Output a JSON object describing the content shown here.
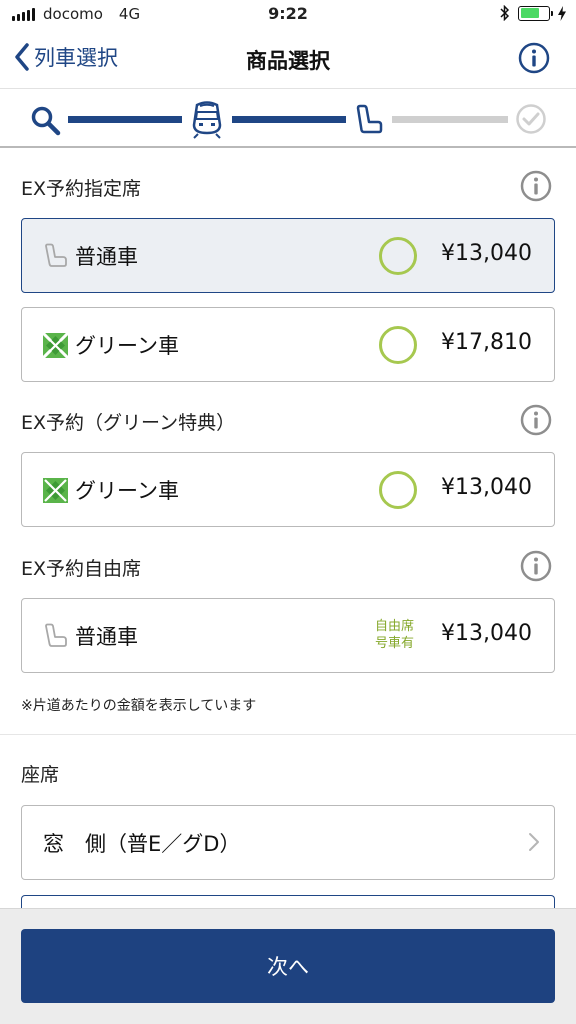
{
  "status_bar": {
    "carrier": "docomo",
    "network": "4G",
    "time": "9:22",
    "battery_level": 0.7
  },
  "nav": {
    "back_label": "列車選択",
    "title": "商品選択",
    "info_icon": "info-circle-icon"
  },
  "progress": {
    "steps": [
      "search-icon",
      "train-icon",
      "seat-icon",
      "check-icon"
    ],
    "current_step": 3
  },
  "sections": [
    {
      "label": "EX予約指定席",
      "options": [
        {
          "icon": "seat-icon",
          "label": "普通車",
          "price": "¥13,040",
          "selected": true
        },
        {
          "icon": "green-car-icon",
          "label": "グリーン車",
          "price": "¥17,810",
          "selected": false
        }
      ]
    },
    {
      "label": "EX予約（グリーン特典）",
      "options": [
        {
          "icon": "green-car-icon",
          "label": "グリーン車",
          "price": "¥13,040",
          "selected": false
        }
      ]
    },
    {
      "label": "EX予約自由席",
      "options": [
        {
          "icon": "seat-icon",
          "label": "普通車",
          "availability": [
            "自由席",
            "号車有"
          ],
          "price": "¥13,040"
        }
      ]
    }
  ],
  "note": "※片道あたりの金額を表示しています",
  "seat": {
    "label": "座席",
    "value": "窓　側（普E／グD）"
  },
  "footer": {
    "next_label": "次へ"
  },
  "colors": {
    "brand_navy": "#1f4685",
    "accent_green": "#a6c84f",
    "green_car": "#5ab44a"
  }
}
